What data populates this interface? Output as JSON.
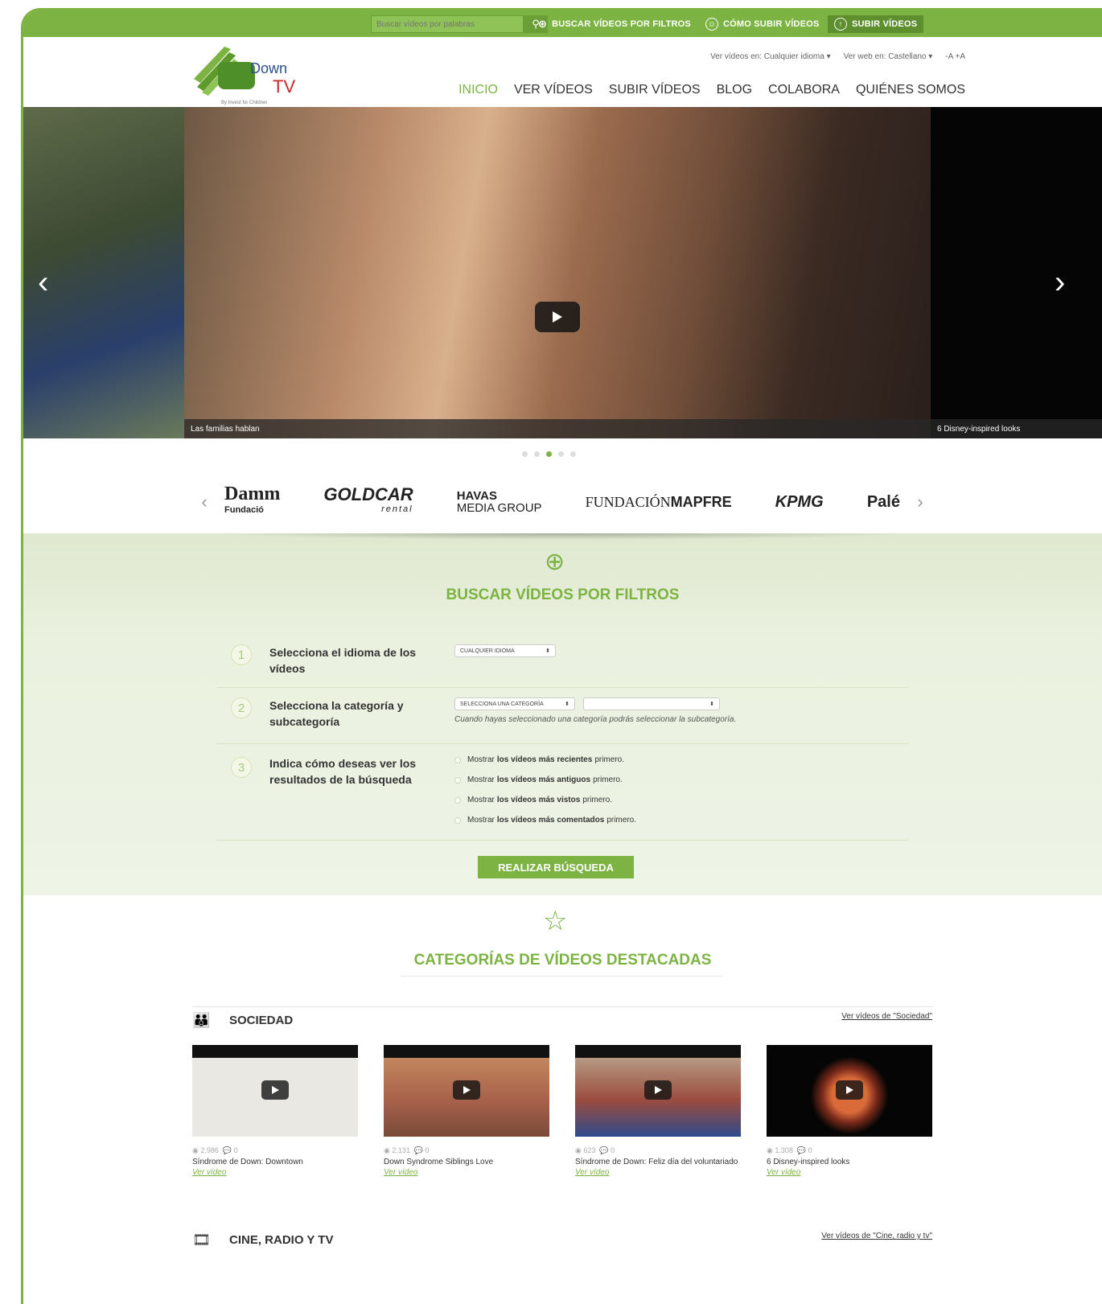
{
  "topbar": {
    "search_placeholder": "Buscar vídeos por palabras",
    "filter_link": "BUSCAR VÍDEOS POR FILTROS",
    "howto_link": "CÓMO SUBIR VÍDEOS",
    "upload_link": "SUBIR VÍDEOS"
  },
  "header": {
    "logo_tagline": "By Invest for Children",
    "video_lang": "Ver vídeos en: Cualquier idioma ▾",
    "web_lang": "Ver web en: Castellano ▾",
    "font_size": "-A  +A",
    "nav": [
      "INICIO",
      "VER VÍDEOS",
      "SUBIR VÍDEOS",
      "BLOG",
      "COLABORA",
      "QUIÉNES SOMOS"
    ]
  },
  "slider": {
    "main_caption": "Las familias hablan",
    "right_caption": "6 Disney-inspired looks"
  },
  "sponsors": {
    "damm": "Damm",
    "damm_sub": "Fundació",
    "goldcar": "GOLDCAR",
    "goldcar_sub": "rental",
    "havas": "HAVAS",
    "havas_sub": "MEDIA GROUP",
    "mapfre_a": "FUNDACIÓN",
    "mapfre_b": "MAPFRE",
    "kpmg": "KPMG",
    "pale": "Palé"
  },
  "filter": {
    "title": "BUSCAR VÍDEOS POR FILTROS",
    "step1_num": "1",
    "step1_label": "Selecciona el idioma de los vídeos",
    "step1_select": "CUALQUIER IDIOMA",
    "step2_num": "2",
    "step2_label": "Selecciona la categoría y subcategoría",
    "step2_select": "SELECCIONA UNA CATEGORÍA",
    "step2_hint": "Cuando hayas seleccionado una categoría podrás seleccionar la subcategoría.",
    "step3_num": "3",
    "step3_label": "Indica cómo deseas ver los resultados de la búsqueda",
    "options": [
      {
        "pre": "Mostrar",
        "bold": "los vídeos más recientes",
        "post": "primero."
      },
      {
        "pre": "Mostrar",
        "bold": "los vídeos más antiguos",
        "post": "primero."
      },
      {
        "pre": "Mostrar",
        "bold": "los vídeos más vistos",
        "post": "primero."
      },
      {
        "pre": "Mostrar",
        "bold": "los vídeos más comentados",
        "post": "primero."
      }
    ],
    "button": "REALIZAR BÚSQUEDA"
  },
  "categories": {
    "title": "CATEGORÍAS DE VÍDEOS DESTACADAS",
    "sociedad": {
      "name": "SOCIEDAD",
      "more": "Ver vídeos de \"Sociedad\"",
      "videos": [
        {
          "views": "2.986",
          "comments": "0",
          "title": "Síndrome de Down: Downtown",
          "link": "Ver vídeo"
        },
        {
          "views": "2.131",
          "comments": "0",
          "title": "Down Syndrome Siblings Love",
          "link": "Ver vídeo"
        },
        {
          "views": "623",
          "comments": "0",
          "title": "Síndrome de Down: Feliz día del voluntariado",
          "link": "Ver vídeo"
        },
        {
          "views": "1.308",
          "comments": "0",
          "title": "6 Disney-inspired looks",
          "link": "Ver vídeo"
        }
      ]
    },
    "cine": {
      "name": "CINE, RADIO Y TV",
      "more": "Ver vídeos de \"Cine, radio y tv\""
    }
  },
  "colors": {
    "brand": "#7cb342"
  }
}
